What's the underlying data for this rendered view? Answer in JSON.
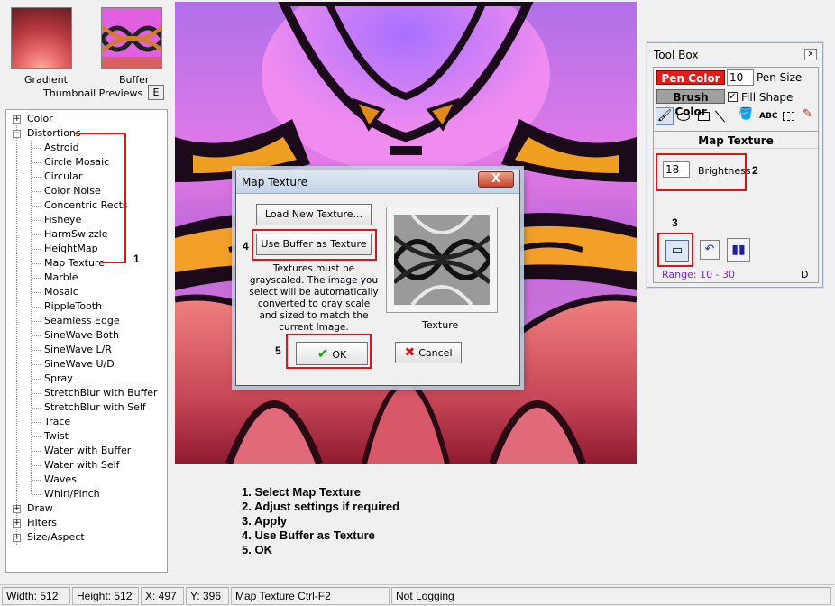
{
  "thumbnails": {
    "gradient_label": "Gradient",
    "buffer_label": "Buffer",
    "caption": "Thumbnail Previews",
    "edit_button": "E"
  },
  "tree": {
    "color": "Color",
    "distortions": "Distortions",
    "items": [
      "Astroid",
      "Circle Mosaic",
      "Circular",
      "Color Noise",
      "Concentric Rects",
      "Fisheye",
      "HarmSwizzle",
      "HeightMap",
      "Map Texture",
      "Marble",
      "Mosaic",
      "RippleTooth",
      "Seamless Edge",
      "SineWave Both",
      "SineWave L/R",
      "SineWave U/D",
      "Spray",
      "StretchBlur with Buffer",
      "StretchBlur with Self",
      "Trace",
      "Twist",
      "Water with Buffer",
      "Water with Self",
      "Waves",
      "Whirl/Pinch"
    ],
    "draw": "Draw",
    "filters": "Filters",
    "size_aspect": "Size/Aspect",
    "expand_glyph": "+",
    "collapse_glyph": "−"
  },
  "dialog": {
    "title": "Map Texture",
    "close": "X",
    "load_button": "Load New Texture...",
    "use_buffer_button": "Use Buffer as Texture",
    "note": "Textures must be grayscaled.  The image you select will be automatically converted to gray scale and sized to match the current Image.",
    "texture_label": "Texture",
    "ok": "OK",
    "cancel": "Cancel"
  },
  "toolbox": {
    "title": "Tool Box",
    "close": "x",
    "pen_color": "Pen Color",
    "pen_size_value": "10",
    "pen_size_label": "Pen Size",
    "brush_color": "Brush Color",
    "fill_shape": "Fill Shape",
    "fill_checked": true,
    "abc": "ABC",
    "section": "Map Texture",
    "brightness_value": "18",
    "brightness_label": "Brightness",
    "range": "Range: 10 - 30",
    "mode": "D"
  },
  "annotations": {
    "n1": "1",
    "n2": "2",
    "n3": "3",
    "n4": "4",
    "n5": "5"
  },
  "instructions": [
    "1. Select Map Texture",
    "2. Adjust settings if required",
    "3. Apply",
    "4. Use Buffer as Texture",
    "5. OK"
  ],
  "status": {
    "width": "Width: 512",
    "height": "Height: 512",
    "x": "X: 497",
    "y": "Y: 396",
    "filter": "Map Texture Ctrl-F2",
    "logging": "Not Logging"
  },
  "colors": {
    "pen": "#e31b1b",
    "accent": "#7a2ad0",
    "annotation": "#d81818"
  }
}
